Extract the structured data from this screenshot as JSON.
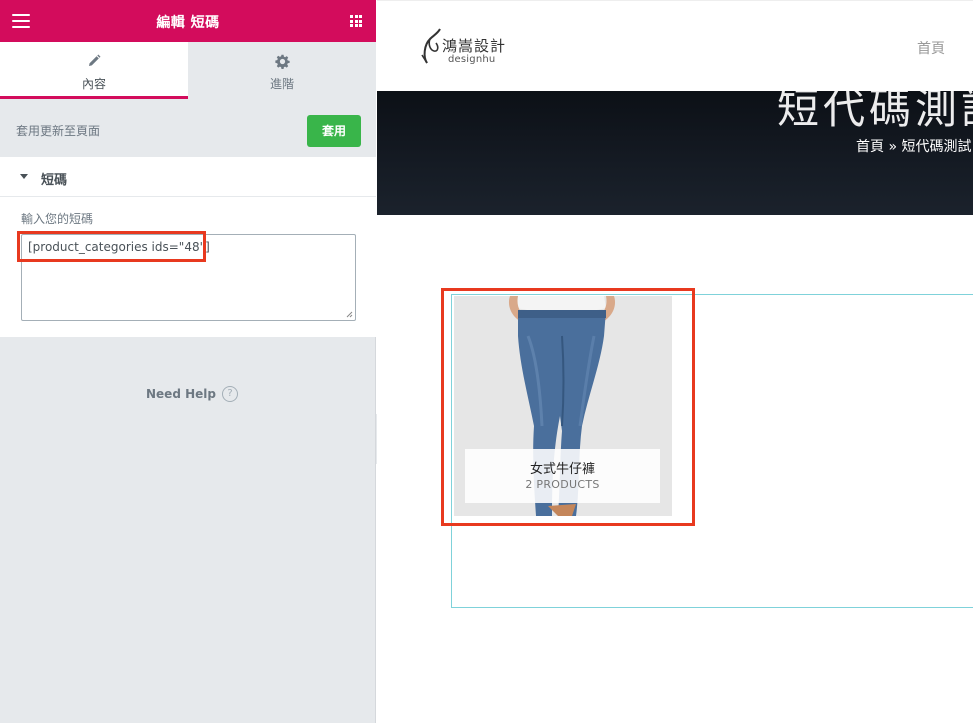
{
  "editor": {
    "title": "編輯 短碼",
    "tabs": [
      {
        "label": "內容",
        "icon": "pencil-icon",
        "active": true
      },
      {
        "label": "進階",
        "icon": "gear-icon",
        "active": false
      }
    ],
    "apply_text": "套用更新至頁面",
    "apply_button": "套用",
    "section_title": "短碼",
    "field_label": "輸入您的短碼",
    "shortcode_value": "[product_categories ids=\"48\"]",
    "need_help": "Need Help",
    "accent_color": "#d30c5c",
    "apply_color": "#39b54a",
    "highlight_color": "#e8391f"
  },
  "preview": {
    "logo_cn": "鴻嵩設計",
    "logo_en": "designhu",
    "nav_home": "首頁",
    "hero_title": "短代碼測試",
    "breadcrumb": "首頁 » 短代碼測試",
    "category": {
      "name": "女式牛仔褲",
      "count": "2 PRODUCTS"
    }
  }
}
